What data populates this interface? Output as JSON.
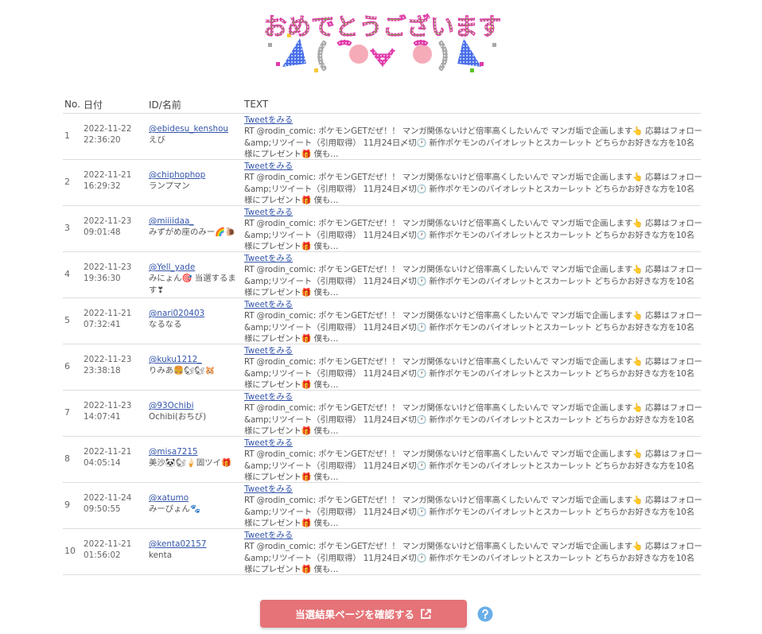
{
  "banner": {
    "text": "おめでとうございます",
    "face": "(๑•̀ㅂ•́)",
    "colors": {
      "green": "#5cc22a",
      "magenta": "#e03aa8",
      "yellow": "#f3c93a",
      "pink": "#f4a3b0",
      "gray": "#a8a8a8",
      "blue": "#4a6ee8"
    }
  },
  "table": {
    "headers": {
      "no": "No.",
      "date": "日付",
      "id": "ID/名前",
      "text": "TEXT"
    },
    "tweet_link_label": "Tweetをみる",
    "rows": [
      {
        "no": "1",
        "date": "2022-11-22",
        "time": "22:36:20",
        "handle": "@ebidesu_kenshou",
        "name": "えび",
        "text": "RT @rodin_comic: ポケモンGETだぜ！！ マンガ関係ないけど倍率高くしたいんで マンガ垢で企画します👆 応募はフォロー&amp;リツイート（引用取得） 11月24日〆切🕐 新作ポケモンのバイオレットとスカーレット どちらかお好きな方を10名様にプレゼント🎁 僕も…"
      },
      {
        "no": "2",
        "date": "2022-11-21",
        "time": "16:29:32",
        "handle": "@chiphophop",
        "name": "ランプマン",
        "text": "RT @rodin_comic: ポケモンGETだぜ！！ マンガ関係ないけど倍率高くしたいんで マンガ垢で企画します👆 応募はフォロー&amp;リツイート（引用取得） 11月24日〆切🕐 新作ポケモンのバイオレットとスカーレット どちらかお好きな方を10名様にプレゼント🎁 僕も…"
      },
      {
        "no": "3",
        "date": "2022-11-23",
        "time": "09:01:48",
        "handle": "@miiiidaa_",
        "name": "みずがめ座のみー🌈🐌",
        "text": "RT @rodin_comic: ポケモンGETだぜ！！ マンガ関係ないけど倍率高くしたいんで マンガ垢で企画します👆 応募はフォロー&amp;リツイート（引用取得） 11月24日〆切🕐 新作ポケモンのバイオレットとスカーレット どちらかお好きな方を10名様にプレゼント🎁 僕も…"
      },
      {
        "no": "4",
        "date": "2022-11-23",
        "time": "19:36:30",
        "handle": "@Yell_yade",
        "name": "みにょん🎯 当選するます❣",
        "text": "RT @rodin_comic: ポケモンGETだぜ！！ マンガ関係ないけど倍率高くしたいんで マンガ垢で企画します👆 応募はフォロー&amp;リツイート（引用取得） 11月24日〆切🕐 新作ポケモンのバイオレットとスカーレット どちらかお好きな方を10名様にプレゼント🎁 僕も…"
      },
      {
        "no": "5",
        "date": "2022-11-21",
        "time": "07:32:41",
        "handle": "@nari020403",
        "name": "なるなる",
        "text": "RT @rodin_comic: ポケモンGETだぜ！！ マンガ関係ないけど倍率高くしたいんで マンガ垢で企画します👆 応募はフォロー&amp;リツイート（引用取得） 11月24日〆切🕐 新作ポケモンのバイオレットとスカーレット どちらかお好きな方を10名様にプレゼント🎁 僕も…"
      },
      {
        "no": "6",
        "date": "2022-11-23",
        "time": "23:38:18",
        "handle": "@kuku1212_",
        "name": "りみあ🍔🐿🐿🐹",
        "text": "RT @rodin_comic: ポケモンGETだぜ！！ マンガ関係ないけど倍率高くしたいんで マンガ垢で企画します👆 応募はフォロー&amp;リツイート（引用取得） 11月24日〆切🕐 新作ポケモンのバイオレットとスカーレット どちらかお好きな方を10名様にプレゼント🎁 僕も…"
      },
      {
        "no": "7",
        "date": "2022-11-23",
        "time": "14:07:41",
        "handle": "@93Ochibi",
        "name": "Ochibi(おちび)",
        "text": "RT @rodin_comic: ポケモンGETだぜ！！ マンガ関係ないけど倍率高くしたいんで マンガ垢で企画します👆 応募はフォロー&amp;リツイート（引用取得） 11月24日〆切🕐 新作ポケモンのバイオレットとスカーレット どちらかお好きな方を10名様にプレゼント🎁 僕も…"
      },
      {
        "no": "8",
        "date": "2022-11-21",
        "time": "04:05:14",
        "handle": "@misa7215",
        "name": "美沙🐼🐿🍦固ツイ🎁",
        "text": "RT @rodin_comic: ポケモンGETだぜ！！ マンガ関係ないけど倍率高くしたいんで マンガ垢で企画します👆 応募はフォロー&amp;リツイート（引用取得） 11月24日〆切🕐 新作ポケモンのバイオレットとスカーレット どちらかお好きな方を10名様にプレゼント🎁 僕も…"
      },
      {
        "no": "9",
        "date": "2022-11-24",
        "time": "09:50:55",
        "handle": "@xatumo",
        "name": "みーぴょん🐾",
        "text": "RT @rodin_comic: ポケモンGETだぜ！！ マンガ関係ないけど倍率高くしたいんで マンガ垢で企画します👆 応募はフォロー&amp;リツイート（引用取得） 11月24日〆切🕐 新作ポケモンのバイオレットとスカーレット どちらかお好きな方を10名様にプレゼント🎁 僕も…"
      },
      {
        "no": "10",
        "date": "2022-11-21",
        "time": "01:56:02",
        "handle": "@kenta02157",
        "name": "kenta",
        "text": "RT @rodin_comic: ポケモンGETだぜ！！ マンガ関係ないけど倍率高くしたいんで マンガ垢で企画します👆 応募はフォロー&amp;リツイート（引用取得） 11月24日〆切🕐 新作ポケモンのバイオレットとスカーレット どちらかお好きな方を10名様にプレゼント🎁 僕も…"
      }
    ]
  },
  "footer": {
    "result_button_label": "当選結果ページを確認する",
    "button_color": "#e57377",
    "external_icon": "external-link-icon",
    "help_icon": "question-circle-icon",
    "help_color": "#6aaee8"
  }
}
